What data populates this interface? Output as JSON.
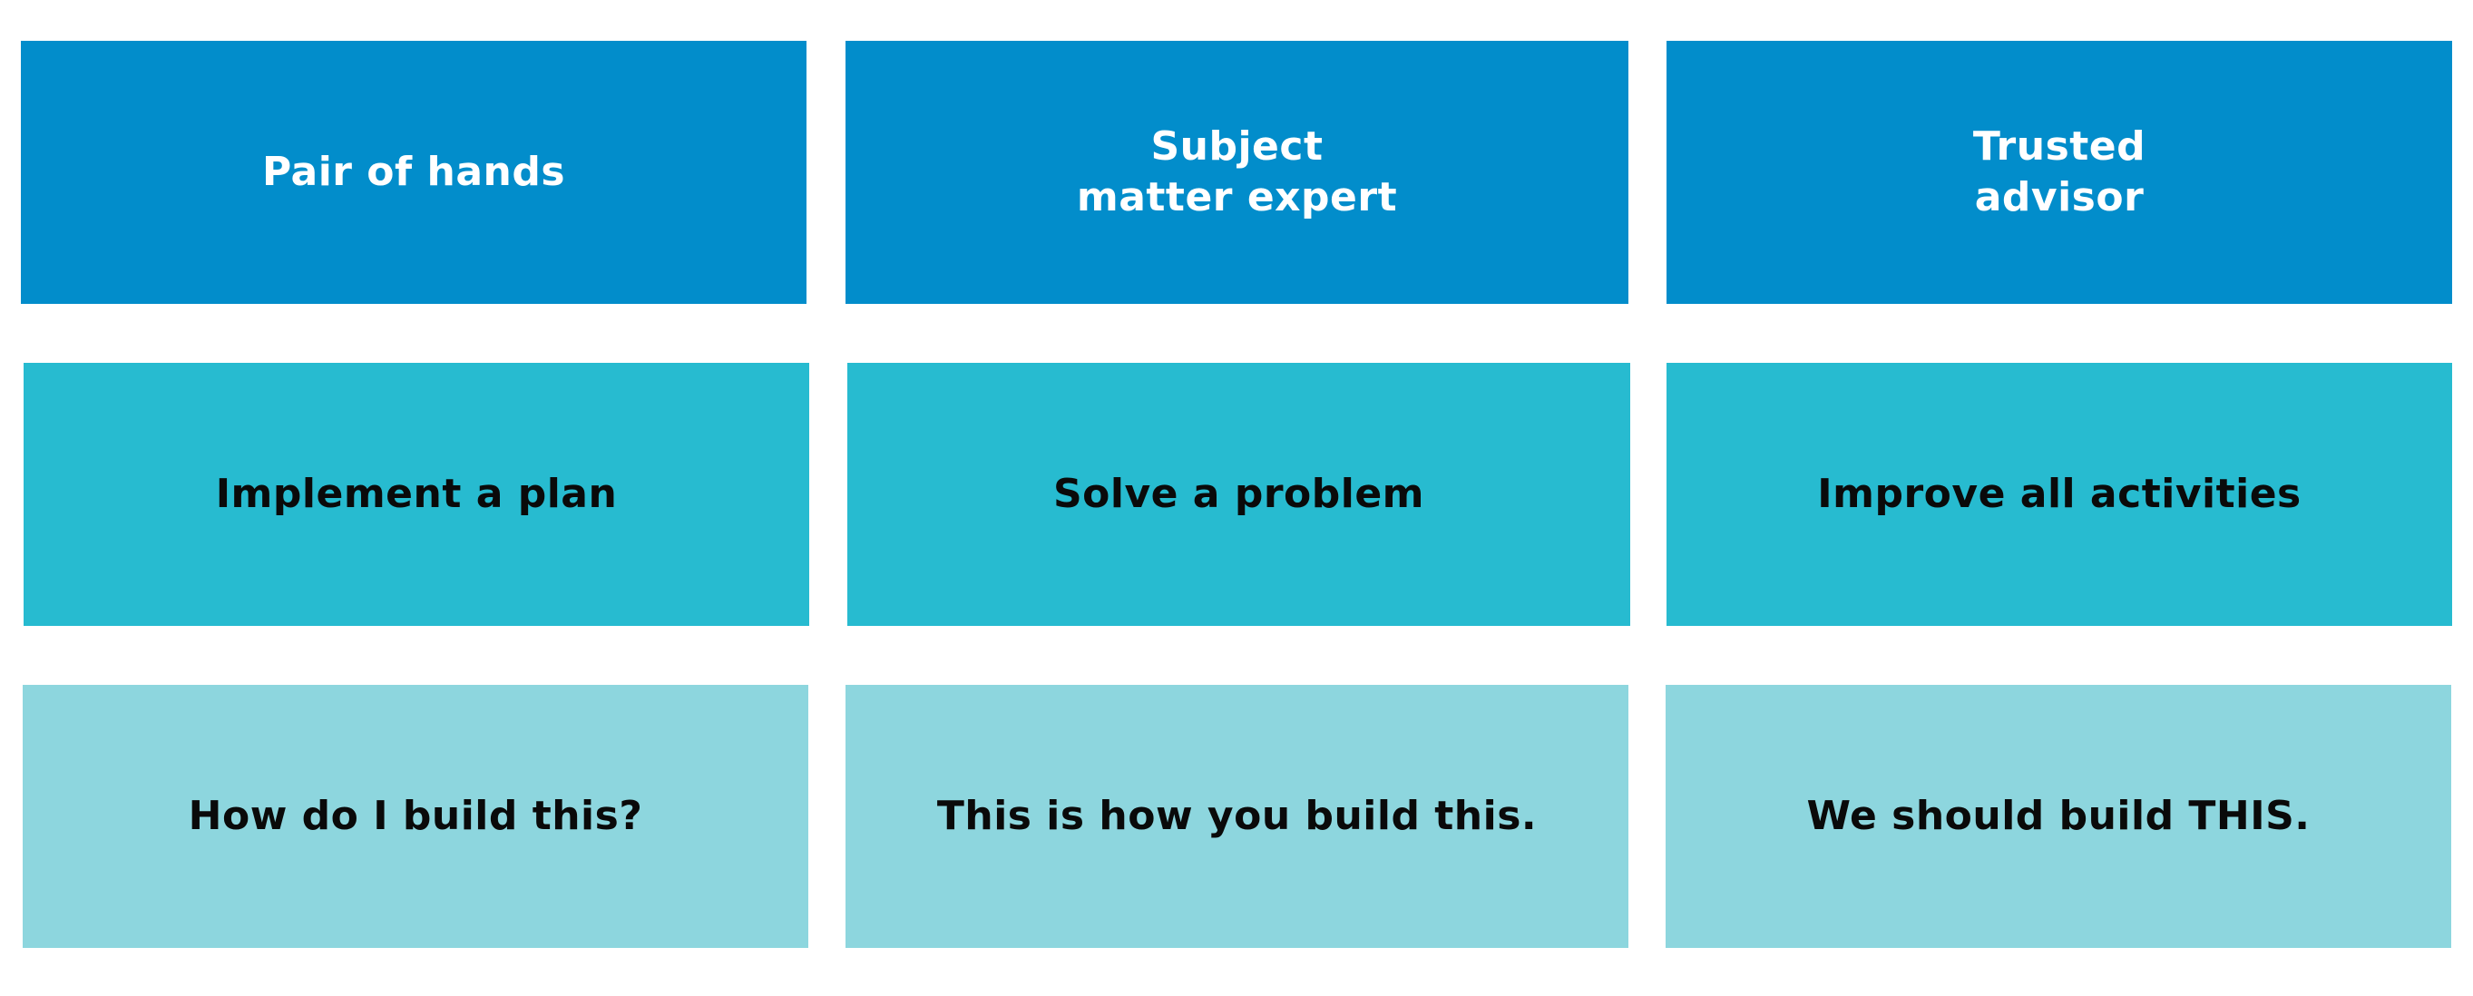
{
  "colors": {
    "row_top_bg": "#028dcb",
    "row_middle_bg": "#27bbd0",
    "row_bottom_bg": "#8dd6de",
    "text_light": "#ffffff",
    "text_dark": "#0a0a0a"
  },
  "columns": [
    {
      "role": "Pair of hands",
      "goal": "Implement a plan",
      "quote": "How do I build this?"
    },
    {
      "role": "Subject\nmatter expert",
      "goal": "Solve a problem",
      "quote": "This is how you build this."
    },
    {
      "role": "Trusted\nadvisor",
      "goal": "Improve all activities",
      "quote": "We should build THIS."
    }
  ]
}
